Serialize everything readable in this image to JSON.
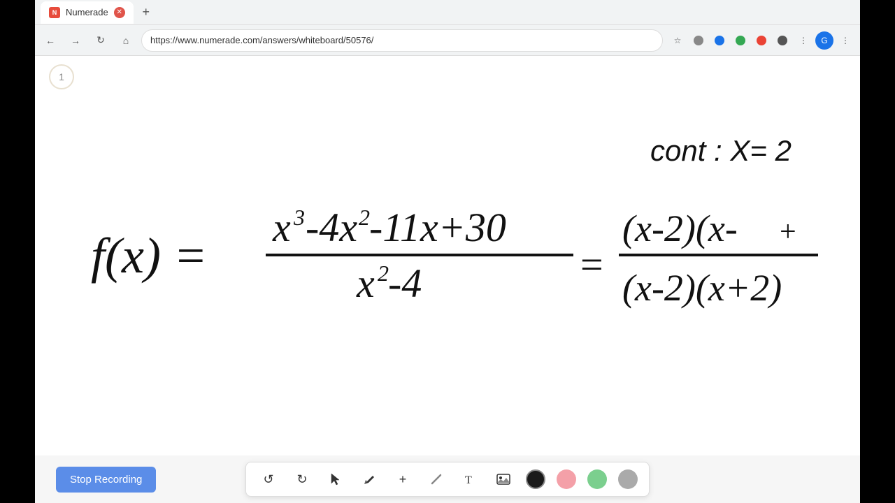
{
  "browser": {
    "tab_title": "Numerade",
    "tab_favicon": "N",
    "url": "https://www.numerade.com/answers/whiteboard/50576/",
    "new_tab_label": "+"
  },
  "nav": {
    "back": "←",
    "forward": "→",
    "refresh": "↻",
    "home": "⌂"
  },
  "page": {
    "number": "1"
  },
  "math": {
    "cont_label": "cont : X= 2"
  },
  "toolbar": {
    "stop_recording_label": "Stop Recording",
    "tools": {
      "undo": "↺",
      "redo": "↻",
      "select": "↖",
      "pen": "✏",
      "add": "+",
      "slash": "/",
      "text": "T",
      "image": "🖼"
    },
    "colors": {
      "black": "#1a1a1a",
      "pink": "#f4a0a8",
      "green": "#7bcf8e",
      "gray": "#aaaaaa"
    }
  }
}
